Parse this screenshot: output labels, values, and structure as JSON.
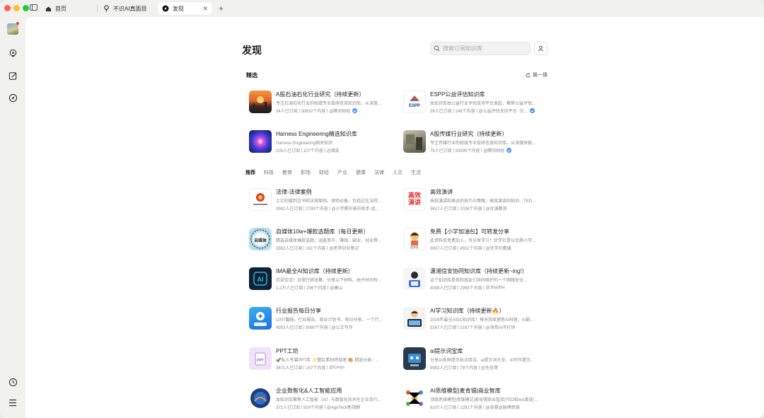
{
  "colors": {
    "accent": "#3b8ff0",
    "traffic_red": "#ff5f57",
    "traffic_yellow": "#febc2e",
    "traffic_green": "#28c840"
  },
  "tabs": [
    {
      "label": "首页",
      "icon": "home-icon"
    },
    {
      "label": "不识AI真面目",
      "icon": "pin-icon"
    },
    {
      "label": "发现",
      "icon": "compass-icon",
      "active": true
    }
  ],
  "page": {
    "title": "发现",
    "search_placeholder": "搜索订阅知识库"
  },
  "featured": {
    "label": "精选",
    "refresh_label": "换一换",
    "items": [
      {
        "title": "A股石油石化行业研究（持续更新）",
        "desc": "专注石油石化行业的权威专业投研信息知识库。从深度...",
        "subs": "34人已订阅",
        "count": "30632个内容",
        "author": "@腾讯财经",
        "verified": true
      },
      {
        "title": "ESPP公益评估知识库",
        "desc": "本知识库由公益行业评估支持平台发起，聚焦公益评估...",
        "subs": "26人已订阅",
        "count": "248个内容",
        "author": "@公益评估支持平台（E...",
        "verified": true
      },
      {
        "title": "Harness Engineering精选知识库",
        "desc": "Harness Engineering相关知识",
        "subs": "105人已订阅",
        "count": "107个内容",
        "author": "@铺友",
        "verified": false
      },
      {
        "title": "A股传媒行业研究（持续更新）",
        "desc": "专注传媒行业的权威专业投研信息知识库。从深度研报...",
        "subs": "76人已订阅",
        "count": "63995个内容",
        "author": "@腾讯财经",
        "verified": true
      }
    ]
  },
  "categories": [
    "推荐",
    "科技",
    "教育",
    "职场",
    "财经",
    "产业",
    "健康",
    "法律",
    "人文",
    "生活"
  ],
  "recommended": [
    {
      "title": "法律-法律案例",
      "desc": "上亿的裁判文书和法规案例。律师必备。包括过往法院...",
      "subs": "3581人已订阅",
      "count": "2789个内容",
      "author": "@小学教中高中助手-追..."
    },
    {
      "title": "高效演讲",
      "desc": "高效演讲和表达的技巧与策略：高效演讲的知识、TED...",
      "subs": "3617人已订阅",
      "count": "2038个内容",
      "author": "@优演教育"
    },
    {
      "title": "自媒体10w+爆款选题库（每日更新）",
      "desc": "精选自媒体爆款选题。涵盖单干、赚钱、副业、创业等...",
      "subs": "3552人已订阅",
      "count": "161个内容",
      "author": "@老李创业笔记"
    },
    {
      "title": "免费【小学加油包】可转发分享",
      "desc": "此资料库免费加入，可分享学习！优学社是以优质小学...",
      "subs": "3837人已订阅",
      "count": "4551个内容",
      "author": "@优学社教辅"
    },
    {
      "title": "IMA最全AI知识库（持续更新）",
      "desc": "欢迎交流！日常行研收集、分享以下材料。由于时间有...",
      "subs": "1.2万人已订阅",
      "count": "299个内容",
      "author": "@康山"
    },
    {
      "title": "潇湘信安协同知识库（持续更新~ing!）",
      "desc": "这个知识库是我和朋友们共同维护的一个网络安全...",
      "subs": "4038人已订阅",
      "count": "2999个内容",
      "author": "@3had0w"
    },
    {
      "title": "行业报告每日分享",
      "desc": "1007篇报。行业报告、商业计划书、每日分享。一个行...",
      "subs": "4953人已订阅",
      "count": "8080个内容",
      "author": "@公文写作"
    },
    {
      "title": "AI学习知识库（持续更新🔥）",
      "desc": "2026年最全AIGC知识库！每天持续更新AI科普、AI副...",
      "subs": "5267人已订阅",
      "count": "2167个内容",
      "author": "@海哥AI不打烊"
    },
    {
      "title": "PPT工坊",
      "desc": "🚀私人专属PPT库 ✨整乱素材终结者 🎨 精选分类：...",
      "subs": "3671人已订阅",
      "count": "157个内容",
      "author": "@Cerys"
    },
    {
      "title": "ai提示词宝库",
      "desc": "分享AI各种提示玩法用法、ai提示词大全、AI写作提示...",
      "subs": "9992人已订阅",
      "count": "79个内容",
      "author": "@先技哥"
    },
    {
      "title": "企业数智化&人工智能应用",
      "desc": "本知识库聚焦人工智能（AI）与数智化技术在企业及行...",
      "subs": "372人已订阅",
      "count": "509个内容",
      "author": "@AgeTech新视野"
    },
    {
      "title": "AI思维模型|麦肯锡|商业智库",
      "desc": "顶级思维模型|思维模式|麦肯锡商业智库|TED和ted演讲|...",
      "subs": "6107人已订阅",
      "count": "1291个内容",
      "author": "@张豪@脉搏思维"
    }
  ]
}
